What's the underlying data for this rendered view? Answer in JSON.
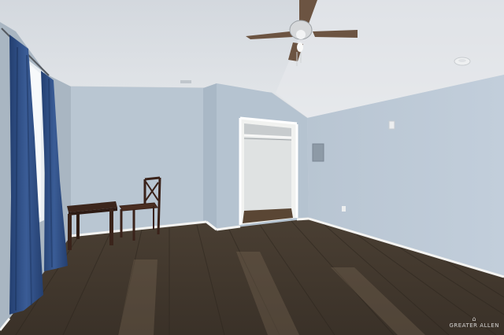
{
  "scene": {
    "description_labels": {
      "room": "empty-bedroom",
      "fixtures": [
        "ceiling-fan",
        "closet",
        "window-curtains",
        "side-table",
        "wooden-chair",
        "electrical-panel",
        "smoke-detector"
      ]
    },
    "colors": {
      "wall": "#b9c7d4",
      "wall_shadow": "#a7b6c4",
      "ceiling": "#d9dee3",
      "floor_dark": "#3b3429",
      "floor_light": "#6b5d4c",
      "curtain": "#2f4f86",
      "baseboard": "#f4f4f2",
      "wood": "#4a2e22"
    }
  },
  "watermark": {
    "text": "GREATER ALLEN"
  }
}
